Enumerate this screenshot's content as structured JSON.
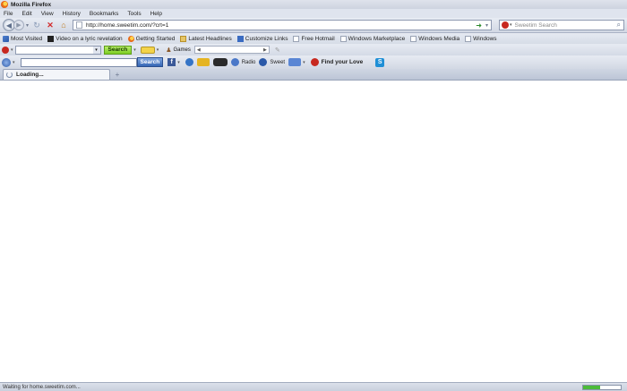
{
  "window": {
    "title": "Mozilla Firefox"
  },
  "menubar": {
    "items": [
      "File",
      "Edit",
      "View",
      "History",
      "Bookmarks",
      "Tools",
      "Help"
    ]
  },
  "navbar": {
    "url": "http://home.sweetim.com/?crt=1",
    "search_placeholder": "Sweetim Search"
  },
  "bookmarks": {
    "items": [
      {
        "label": "Most Visited",
        "icon": "most-visited-icon"
      },
      {
        "label": "Video on a lyric revelation",
        "icon": "video-icon"
      },
      {
        "label": "Getting Started",
        "icon": "firefox-icon"
      },
      {
        "label": "Latest Headlines",
        "icon": "rss-folder-icon"
      },
      {
        "label": "Customize Links",
        "icon": "link-icon"
      },
      {
        "label": "Free Hotmail",
        "icon": "page-icon"
      },
      {
        "label": "Windows Marketplace",
        "icon": "page-icon"
      },
      {
        "label": "Windows Media",
        "icon": "page-icon"
      },
      {
        "label": "Windows",
        "icon": "page-icon"
      }
    ]
  },
  "toolbar1": {
    "search_button": "Search",
    "games_label": "Games"
  },
  "toolbar2": {
    "search_button": "Search",
    "radio_label": "Radio",
    "sweet_label": "Sweet",
    "find_love_label": "Find your Love"
  },
  "tabs": [
    {
      "title": "Loading..."
    }
  ],
  "status": {
    "text": "Waiting for home.sweetim.com...",
    "progress": 0.45
  },
  "colors": {
    "accent": "#3566b5",
    "progress": "#4cbb3a",
    "stop": "#d32b2b"
  }
}
